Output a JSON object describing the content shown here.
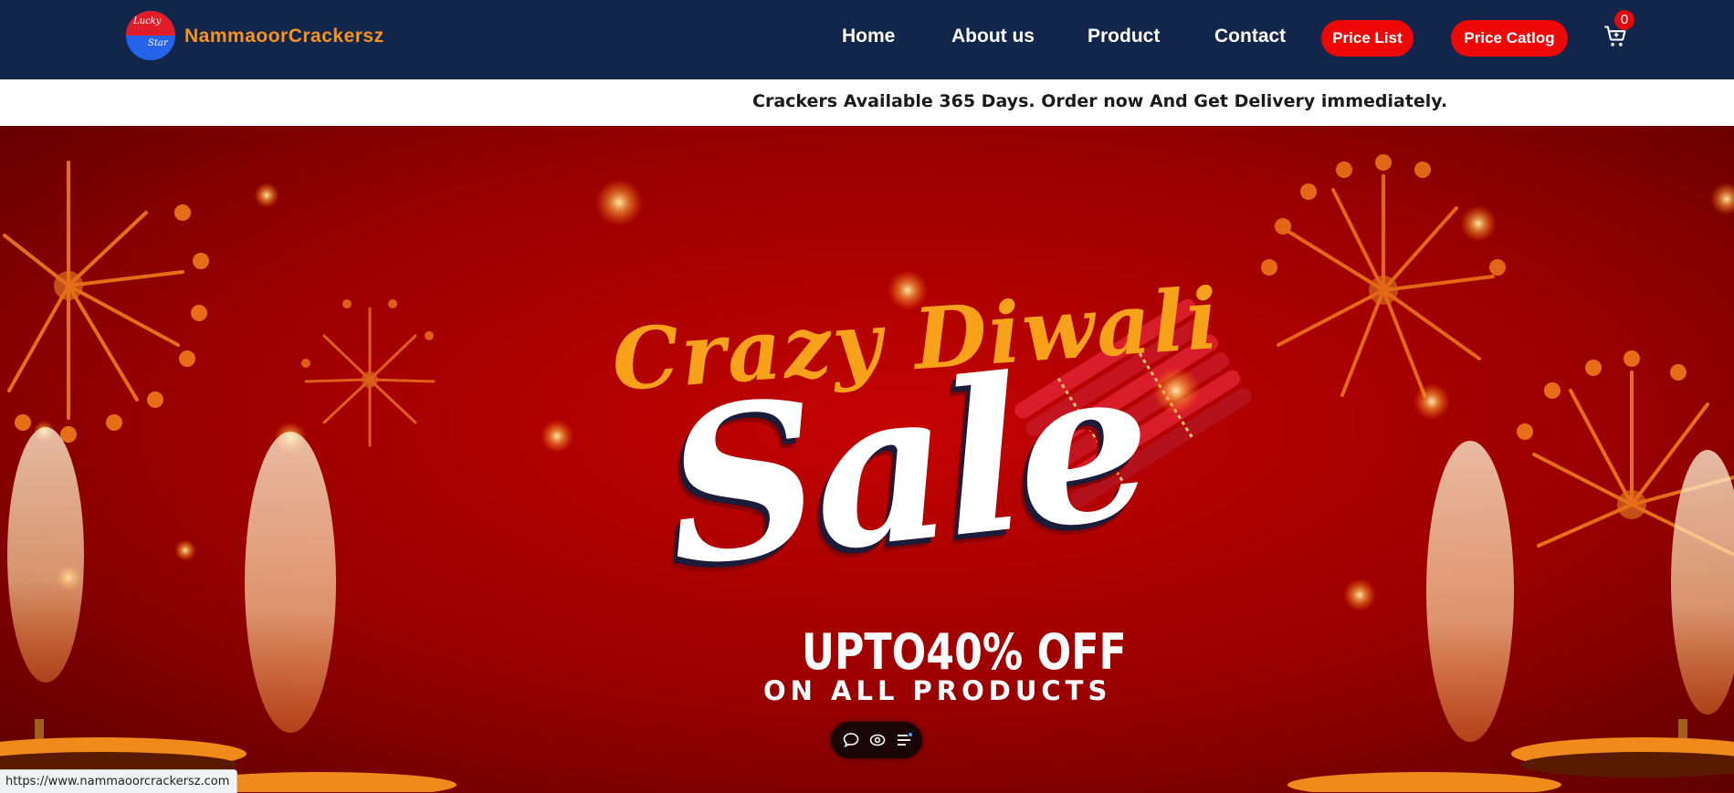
{
  "header": {
    "logo_text_top": "Lucky",
    "logo_text_bottom": "Star",
    "brand": "NammaoorCrackersz",
    "nav": [
      {
        "label": "Home"
      },
      {
        "label": "About us"
      },
      {
        "label": "Product"
      },
      {
        "label": "Contact"
      }
    ],
    "price_list_label": "Price List",
    "price_catalog_label": "Price Catlog",
    "cart_count": "0"
  },
  "ticker": {
    "text": "Crackers Available 365 Days. Order now And Get Delivery immediately."
  },
  "hero": {
    "headline": "Crazy Diwali",
    "title": "Sale",
    "offer": "UPTO40% OFF",
    "subline": "ON ALL PRODUCTS"
  },
  "floating_toolbar": {
    "icons": [
      "chat-icon",
      "eye-icon",
      "menu-icon"
    ]
  },
  "status_bar": {
    "url": "https://www.nammaoorcrackersz.com"
  },
  "colors": {
    "header_bg": "#12254a",
    "brand": "#f5941e",
    "accent_red": "#ee0707",
    "hero_red": "#a80000",
    "headline_orange": "#f7a21a"
  }
}
